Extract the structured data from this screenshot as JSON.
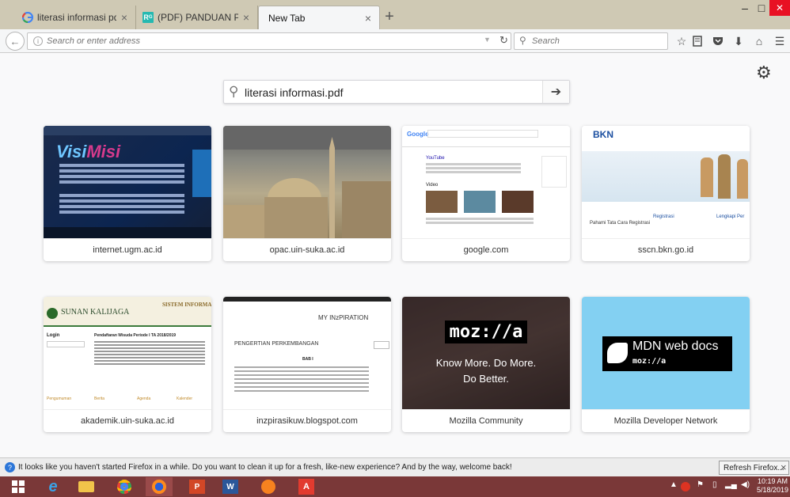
{
  "tabs": [
    {
      "title": "literasi informasi pdf - Pen...",
      "favicon": "google-icon"
    },
    {
      "title": "(PDF) PANDUAN PROGRA...",
      "favicon": "researchgate-icon"
    },
    {
      "title": "New Tab",
      "favicon": ""
    }
  ],
  "navbar": {
    "url_placeholder": "Search or enter address",
    "search_placeholder": "Search"
  },
  "newtab": {
    "search_value": "literasi informasi.pdf",
    "topsites": [
      {
        "label": "internet.ugm.ac.id",
        "visi": "Visi",
        "misi": "Misi"
      },
      {
        "label": "opac.uin-suka.ac.id"
      },
      {
        "label": "google.com",
        "brand": "Google",
        "result_title": "YouTube",
        "section": "Video"
      },
      {
        "label": "sscn.bkn.go.id",
        "brand": "BKN",
        "nav1": "Registrasi",
        "nav2": "Lengkapi Per",
        "caption": "Pahami Tata Cara Registrasi"
      },
      {
        "label": "akademik.uin-suka.ac.id",
        "brand": "SUNAN KALIJAGA",
        "header_right": "SISTEM INFORMAS",
        "login": "Login",
        "title": "Pendaftaran Wisuda Periode I TA 2018/2019",
        "col1": "Pengumuman",
        "col2": "Berita",
        "col3": "Agenda",
        "col4": "Kalender"
      },
      {
        "label": "inzpirasikuw.blogspot.com",
        "site_title": "MY INzPIRATION",
        "heading": "PENGERTIAN PERKEMBANGAN",
        "sub": "BAB I"
      },
      {
        "label": "Mozilla Community",
        "logo": "moz://a",
        "line1": "Know More. Do More.",
        "line2": "Do Better."
      },
      {
        "label": "Mozilla Developer Network",
        "title": "MDN web docs",
        "sub": "moz://a"
      }
    ]
  },
  "notification": {
    "text": "It looks like you haven't started Firefox in a while. Do you want to clean it up for a fresh, like-new experience? And by the way, welcome back!",
    "button": "Refresh Firefox...",
    "close": "×"
  },
  "taskbar": {
    "time": "10:19 AM",
    "date": "5/18/2019"
  },
  "colors": {
    "titlebar": "#cfc9b4",
    "taskbar": "#7a3838",
    "mdn_bg": "#83d0f2",
    "close_button": "#e81123"
  }
}
